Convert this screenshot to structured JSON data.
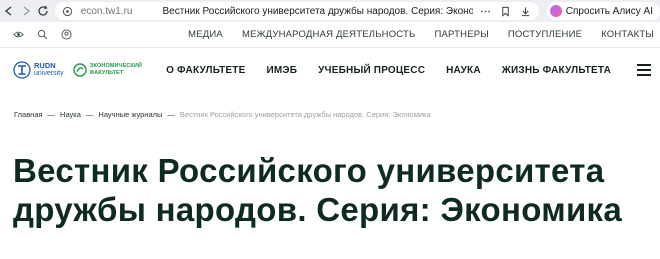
{
  "browser": {
    "url": "econ.tw1.ru",
    "tab_title": "Вестник Российского университета дружбы народов. Серия: Экономика",
    "alice_label": "Спросить Алису AI"
  },
  "util_bar": {
    "links": [
      "МЕДИА",
      "МЕЖДУНАРОДНАЯ ДЕЯТЕЛЬНОСТЬ",
      "ПАРТНЕРЫ",
      "ПОСТУПЛЕНИЕ",
      "КОНТАКТЫ"
    ]
  },
  "logos": {
    "rudn_line1": "RUDN",
    "rudn_line2": "university",
    "econ_line1": "ЭКОНОМИЧЕСКИЙ",
    "econ_line2": "ФАКУЛЬТЕТ"
  },
  "main_nav": {
    "items": [
      "О ФАКУЛЬТЕТЕ",
      "ИМЭБ",
      "УЧЕБНЫЙ ПРОЦЕСС",
      "НАУКА",
      "ЖИЗНЬ ФАКУЛЬТЕТА"
    ]
  },
  "breadcrumb": {
    "items": [
      "Главная",
      "Наука",
      "Научные журналы"
    ],
    "separator": "—",
    "current": "Вестник Российского университета дружбы народов. Серия: Экономика"
  },
  "page": {
    "title": "Вестник Российского университета дружбы народов. Серия: Экономика"
  },
  "colors": {
    "accent_green": "#1f9a4a",
    "brand_blue": "#1e5aa8",
    "title": "#0f2a1f"
  }
}
